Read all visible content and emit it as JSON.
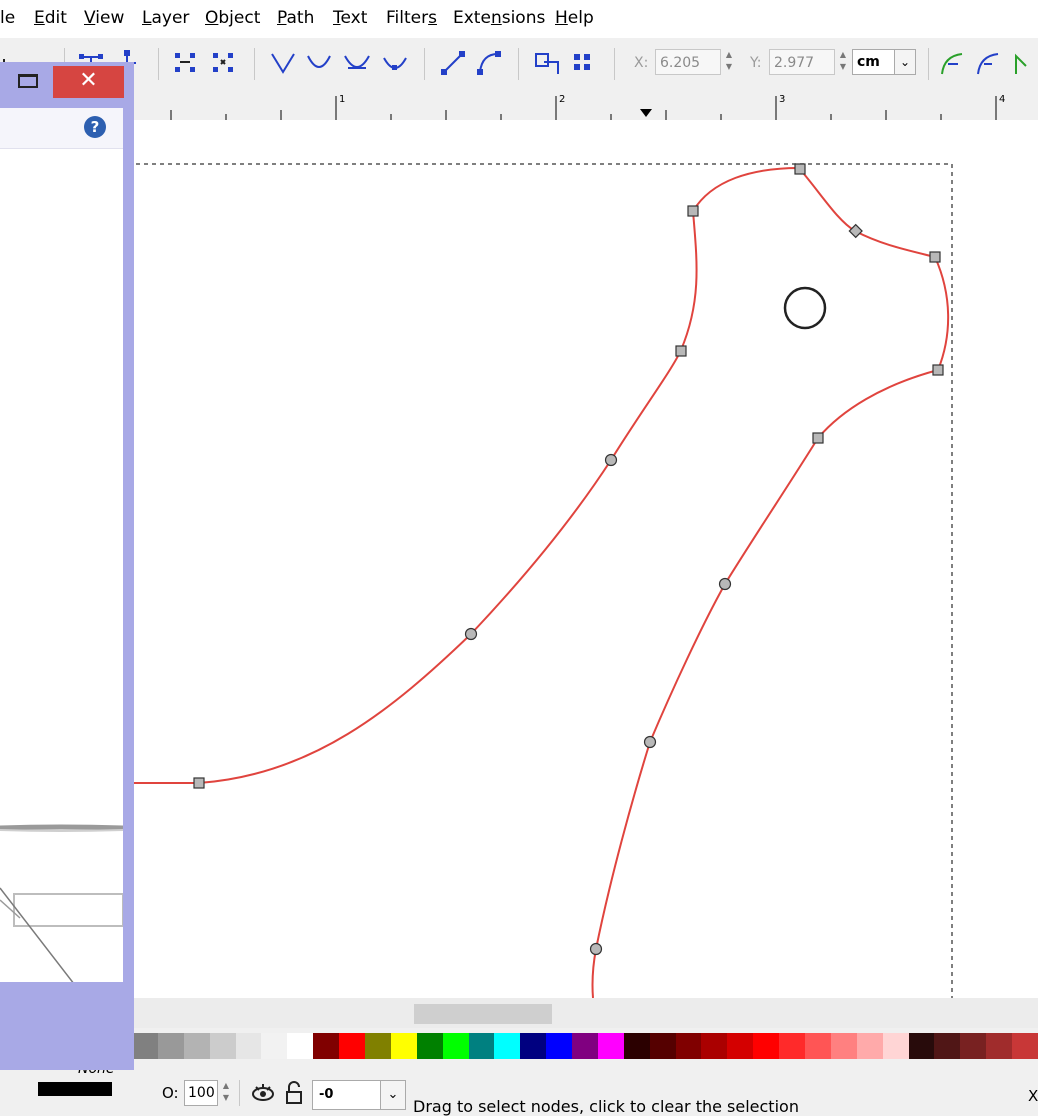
{
  "menu": {
    "items": [
      {
        "label": "le",
        "underline_index": -1
      },
      {
        "label": "Edit",
        "underline_index": 0
      },
      {
        "label": "View",
        "underline_index": 0
      },
      {
        "label": "Layer",
        "underline_index": 0
      },
      {
        "label": "Object",
        "underline_index": 0
      },
      {
        "label": "Path",
        "underline_index": 0
      },
      {
        "label": "Text",
        "underline_index": 0
      },
      {
        "label": "Filters",
        "underline_index": 6
      },
      {
        "label": "Extensions",
        "underline_index": 4
      },
      {
        "label": "Help",
        "underline_index": 0
      }
    ]
  },
  "toolbar": {
    "x_label": "X:",
    "x_value": "6.205",
    "y_label": "Y:",
    "y_value": "2.977",
    "unit": "cm",
    "icons": [
      "node-insert-icon",
      "node-delete-icon",
      "join-nodes-icon",
      "break-path-icon",
      "join-segment-icon",
      "delete-segment-icon",
      "cusp-node-icon",
      "smooth-node-icon",
      "symmetric-node-icon",
      "auto-smooth-node-icon",
      "segment-to-line-icon",
      "segment-to-curve-icon",
      "object-to-path-icon",
      "stroke-to-path-icon",
      "next-path-effect-icon",
      "clip-path-effect-icon",
      "mask-path-effect-icon"
    ]
  },
  "ruler": {
    "marks": [
      "1",
      "2",
      "3",
      "4"
    ]
  },
  "dialog": {
    "close_label": "✕",
    "help_label": "?"
  },
  "palette": {
    "colors": [
      "#808080",
      "#999999",
      "#b3b3b3",
      "#cccccc",
      "#e6e6e6",
      "#f2f2f2",
      "#ffffff",
      "#800000",
      "#ff0000",
      "#808000",
      "#ffff00",
      "#008000",
      "#00ff00",
      "#008080",
      "#00ffff",
      "#000080",
      "#0000ff",
      "#800080",
      "#ff00ff",
      "#2b0000",
      "#550000",
      "#800000",
      "#aa0000",
      "#d40000",
      "#ff0000",
      "#ff2a2a",
      "#ff5555",
      "#ff8080",
      "#ffaaaa",
      "#ffd5d5",
      "#280b0b",
      "#501616",
      "#782121",
      "#a02c2c",
      "#c83737"
    ]
  },
  "statusbar": {
    "stroke_none": "None",
    "opacity_label": "O:",
    "opacity_value": "100",
    "rotation_value": "-0",
    "message": "Drag to select nodes, click to clear the selection",
    "coord_label": "X:"
  }
}
